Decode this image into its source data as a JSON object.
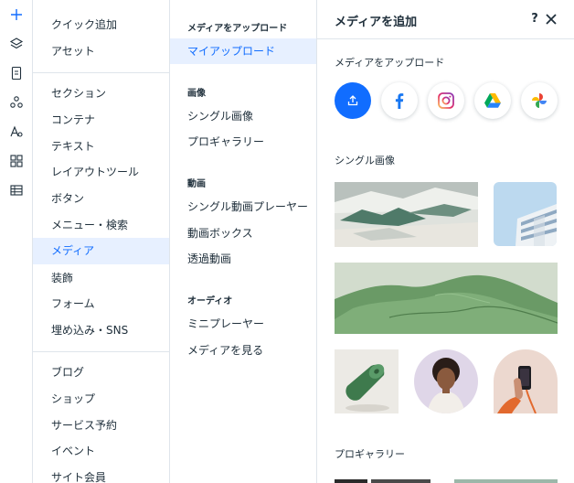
{
  "column1": {
    "group1": [
      "クイック追加",
      "アセット"
    ],
    "group2": [
      "セクション",
      "コンテナ",
      "テキスト",
      "レイアウトツール",
      "ボタン",
      "メニュー・検索",
      "メディア",
      "装飾",
      "フォーム",
      "埋め込み・SNS"
    ],
    "group3": [
      "ブログ",
      "ショップ",
      "サービス予約",
      "イベント",
      "サイト会員"
    ],
    "selected": "メディア"
  },
  "column2": {
    "sections": [
      {
        "header": "メディアをアップロード",
        "items": [
          "マイアップロード"
        ]
      },
      {
        "header": "画像",
        "items": [
          "シングル画像",
          "プロギャラリー"
        ]
      },
      {
        "header": "動画",
        "items": [
          "シングル動画プレーヤー",
          "動画ボックス",
          "透過動画"
        ]
      },
      {
        "header": "オーディオ",
        "items": [
          "ミニプレーヤー",
          "メディアを見る"
        ]
      }
    ],
    "selected": "マイアップロード"
  },
  "panel": {
    "title": "メディアを追加",
    "help": "?",
    "upload_section": "メディアをアップロード",
    "upload_sources": [
      "upload-icon",
      "facebook-icon",
      "instagram-icon",
      "google-drive-icon",
      "google-photos-icon"
    ],
    "single_image_section": "シングル画像",
    "pro_gallery_section": "プロギャラリー"
  },
  "colors": {
    "accent": "#116dff",
    "selected_bg": "#e7f0ff",
    "border": "#dfe5eb",
    "text": "#20303c",
    "facebook": "#1877f2",
    "instagram": "#d6249f"
  }
}
